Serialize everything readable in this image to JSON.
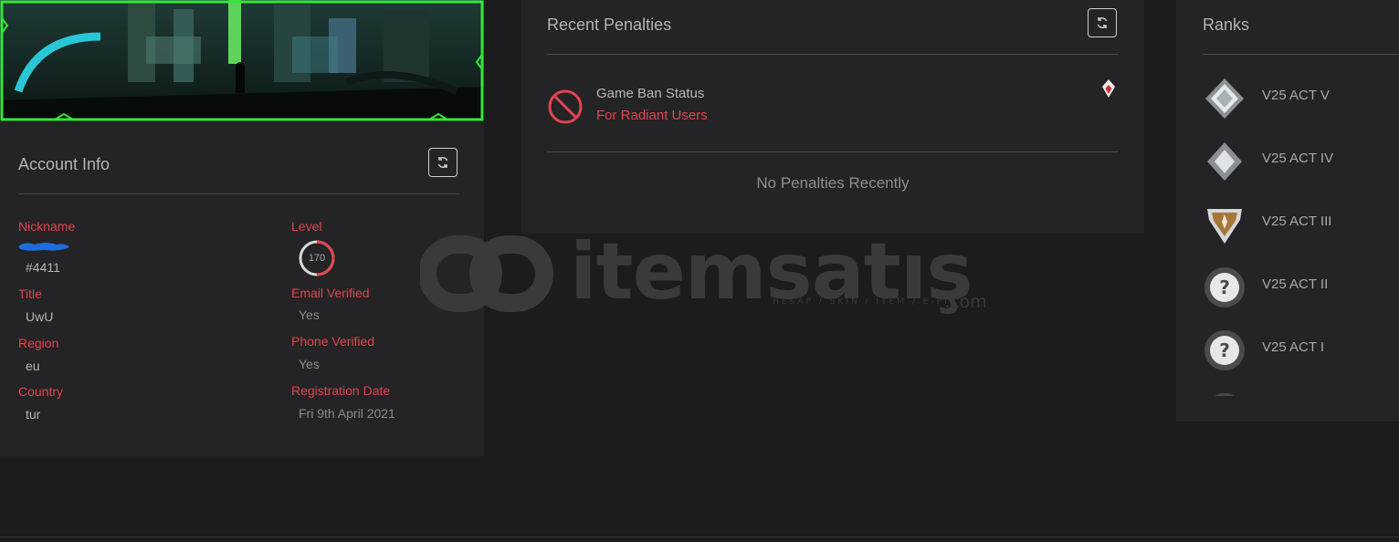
{
  "account": {
    "title": "Account Info",
    "fields_left": [
      {
        "label": "Nickname",
        "value": "#4411"
      },
      {
        "label": "Title",
        "value": "UwU"
      },
      {
        "label": "Region",
        "value": "eu"
      },
      {
        "label": "Country",
        "value": "tur"
      }
    ],
    "fields_right": [
      {
        "label": "Level",
        "value": "170"
      },
      {
        "label": "Email Verified",
        "value": "Yes"
      },
      {
        "label": "Phone Verified",
        "value": "Yes"
      },
      {
        "label": "Registration Date",
        "value": "Fri 9th April 2021"
      }
    ],
    "level_progress": 0.5
  },
  "penalties": {
    "title": "Recent Penalties",
    "ban_title": "Game Ban Status",
    "ban_subtitle": "For Radiant Users",
    "empty_text": "No Penalties Recently"
  },
  "ranks": {
    "title": "Ranks",
    "items": [
      {
        "label": "V25 ACT V",
        "icon": "platinum-rank-icon"
      },
      {
        "label": "V25 ACT IV",
        "icon": "platinum-rank-icon"
      },
      {
        "label": "V25 ACT III",
        "icon": "gold-ascendant-rank-icon"
      },
      {
        "label": "V25 ACT II",
        "icon": "unranked-question-icon"
      },
      {
        "label": "V25 ACT I",
        "icon": "unranked-question-icon"
      }
    ]
  },
  "watermark": {
    "brand": "itemsatış",
    "tagline": "HESAP / SKIN / ITEM / E-PIN",
    "suffix": ".com"
  },
  "colors": {
    "accent_red": "#e04650",
    "banner_border": "#35e63c",
    "panel_bg": "#242325",
    "page_bg": "#1c1b1d"
  }
}
